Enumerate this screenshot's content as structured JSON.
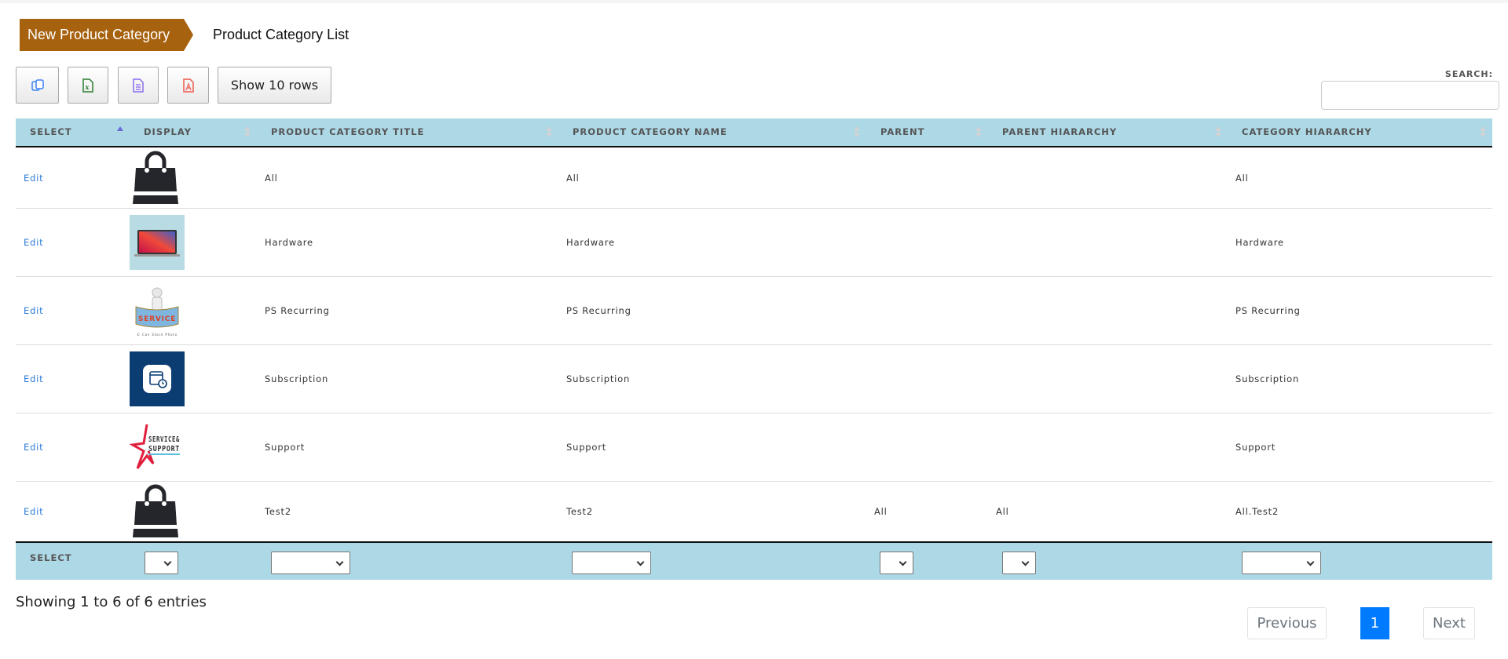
{
  "breadcrumb": {
    "action_label": "New Product Category",
    "current_label": "Product Category List",
    "accent_color": "#a6620f"
  },
  "toolbar": {
    "buttons": [
      {
        "icon": "copy-icon",
        "label": "Copy"
      },
      {
        "icon": "excel-icon",
        "label": "Excel"
      },
      {
        "icon": "csv-icon",
        "label": "CSV"
      },
      {
        "icon": "pdf-icon",
        "label": "PDF"
      }
    ],
    "rows_label": "Show 10 rows"
  },
  "search": {
    "label": "SEARCH:",
    "value": "",
    "placeholder": ""
  },
  "table": {
    "header_bg": "#add8e6",
    "columns": [
      {
        "label": "SELECT",
        "sort": "asc"
      },
      {
        "label": "DISPLAY",
        "sort": "none"
      },
      {
        "label": "PRODUCT CATEGORY TITLE",
        "sort": "none"
      },
      {
        "label": "PRODUCT CATEGORY NAME",
        "sort": "none"
      },
      {
        "label": "PARENT",
        "sort": "none"
      },
      {
        "label": "PARENT HIARARCHY",
        "sort": "none"
      },
      {
        "label": "CATEGORY HIARARCHY",
        "sort": "none"
      }
    ],
    "rows": [
      {
        "action": "Edit",
        "image": "shopping-bag-icon",
        "title": "All",
        "name": "All",
        "parent": "",
        "parent_hierarchy": "",
        "category_hierarchy": "All"
      },
      {
        "action": "Edit",
        "image": "laptop-image",
        "title": "Hardware",
        "name": "Hardware",
        "parent": "",
        "parent_hierarchy": "",
        "category_hierarchy": "Hardware"
      },
      {
        "action": "Edit",
        "image": "service-image",
        "title": "PS Recurring",
        "name": "PS Recurring",
        "parent": "",
        "parent_hierarchy": "",
        "category_hierarchy": "PS Recurring"
      },
      {
        "action": "Edit",
        "image": "calendar-subscription-image",
        "title": "Subscription",
        "name": "Subscription",
        "parent": "",
        "parent_hierarchy": "",
        "category_hierarchy": "Subscription"
      },
      {
        "action": "Edit",
        "image": "service-support-image",
        "title": "Support",
        "name": "Support",
        "parent": "",
        "parent_hierarchy": "",
        "category_hierarchy": "Support"
      },
      {
        "action": "Edit",
        "image": "shopping-bag-icon",
        "title": "Test2",
        "name": "Test2",
        "parent": "All",
        "parent_hierarchy": "All",
        "category_hierarchy": "All.Test2"
      }
    ],
    "footer": {
      "label": "SELECT",
      "filters": [
        "",
        "",
        "",
        "",
        "",
        ""
      ]
    }
  },
  "pagination": {
    "info": "Showing 1 to 6 of 6 entries",
    "previous_label": "Previous",
    "pages": [
      "1"
    ],
    "current_page": "1",
    "next_label": "Next",
    "active_color": "#007bff"
  }
}
